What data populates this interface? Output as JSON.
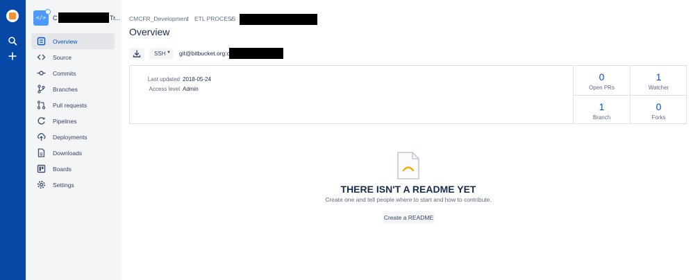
{
  "global_nav": {
    "icons": [
      "bitbucket-logo-icon",
      "search-icon",
      "create-plus-icon"
    ]
  },
  "repo": {
    "avatar_glyph": "</>",
    "name_start": "C",
    "name_end": "Tr..."
  },
  "sidebar": {
    "items": [
      {
        "label": "Overview",
        "icon": "overview-icon",
        "active": true
      },
      {
        "label": "Source",
        "icon": "code-icon",
        "active": false
      },
      {
        "label": "Commits",
        "icon": "commit-icon",
        "active": false
      },
      {
        "label": "Branches",
        "icon": "branch-icon",
        "active": false
      },
      {
        "label": "Pull requests",
        "icon": "pull-request-icon",
        "active": false
      },
      {
        "label": "Pipelines",
        "icon": "pipelines-icon",
        "active": false
      },
      {
        "label": "Deployments",
        "icon": "deployments-icon",
        "active": false
      },
      {
        "label": "Downloads",
        "icon": "downloads-icon",
        "active": false
      },
      {
        "label": "Boards",
        "icon": "boards-icon",
        "active": false
      },
      {
        "label": "Settings",
        "icon": "gear-icon",
        "active": false
      }
    ]
  },
  "breadcrumb": {
    "items": [
      "CMCFR_Development",
      "ETL PROCESS"
    ],
    "separator": "/"
  },
  "page": {
    "title": "Overview"
  },
  "clone": {
    "protocol": "SSH",
    "url": "git@bitbucket.org:c"
  },
  "meta": {
    "last_updated_label": "Last updated",
    "last_updated_value": "2018-05-24",
    "access_level_label": "Access level",
    "access_level_value": "Admin"
  },
  "stats": {
    "open_prs": {
      "value": "0",
      "label": "Open PRs"
    },
    "watchers": {
      "value": "1",
      "label": "Watcher"
    },
    "branches": {
      "value": "1",
      "label": "Branch"
    },
    "forks": {
      "value": "0",
      "label": "Forks"
    }
  },
  "readme": {
    "title": "THERE ISN'T A README YET",
    "subtitle": "Create one and tell people where to start and how to contribute.",
    "button_label": "Create a README"
  },
  "colors": {
    "global_nav_bg": "#0747a6",
    "sidebar_bg": "#f4f5f7",
    "link_blue": "#0052cc",
    "accent_orange": "#f79232",
    "readme_icon_yellow": "#ffab00"
  }
}
